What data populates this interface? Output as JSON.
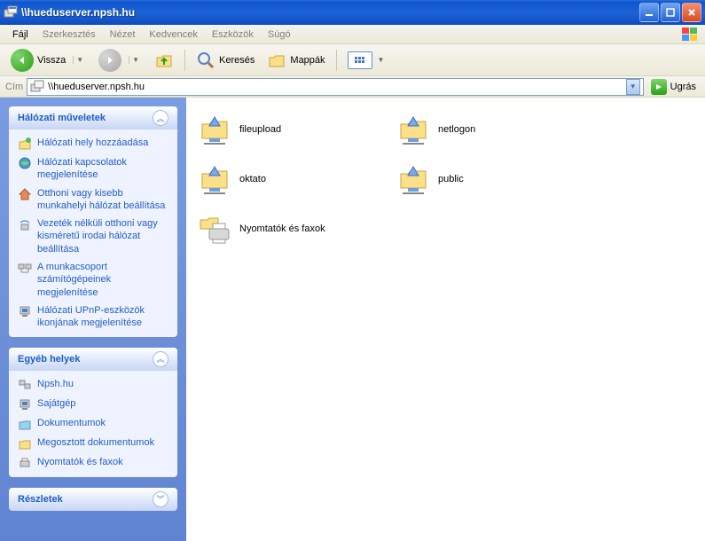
{
  "window": {
    "title": "\\\\hueduserver.npsh.hu"
  },
  "menubar": [
    "Fájl",
    "Szerkesztés",
    "Nézet",
    "Kedvencek",
    "Eszközök",
    "Súgó"
  ],
  "toolbar": {
    "back": "Vissza",
    "search": "Keresés",
    "folders": "Mappák"
  },
  "addressbar": {
    "label": "Cím",
    "value": "\\\\hueduserver.npsh.hu",
    "go": "Ugrás"
  },
  "sidebar": {
    "panel1": {
      "title": "Hálózati műveletek",
      "items": [
        "Hálózati hely hozzáadása",
        "Hálózati kapcsolatok megjelenítése",
        "Otthoni vagy kisebb munkahelyi hálózat beállítása",
        "Vezeték nélküli otthoni vagy kisméretű irodai hálózat beállítása",
        "A munkacsoport számítógépeinek megjelenítése",
        "Hálózati UPnP-eszközök ikonjának megjelenítése"
      ]
    },
    "panel2": {
      "title": "Egyéb helyek",
      "items": [
        "Npsh.hu",
        "Sajátgép",
        "Dokumentumok",
        "Megosztott dokumentumok",
        "Nyomtatók és faxok"
      ]
    },
    "panel3": {
      "title": "Részletek"
    }
  },
  "files": [
    {
      "name": "fileupload",
      "type": "share"
    },
    {
      "name": "netlogon",
      "type": "share"
    },
    {
      "name": "oktato",
      "type": "share"
    },
    {
      "name": "public",
      "type": "share"
    },
    {
      "name": "Nyomtatók és faxok",
      "type": "printer"
    }
  ]
}
